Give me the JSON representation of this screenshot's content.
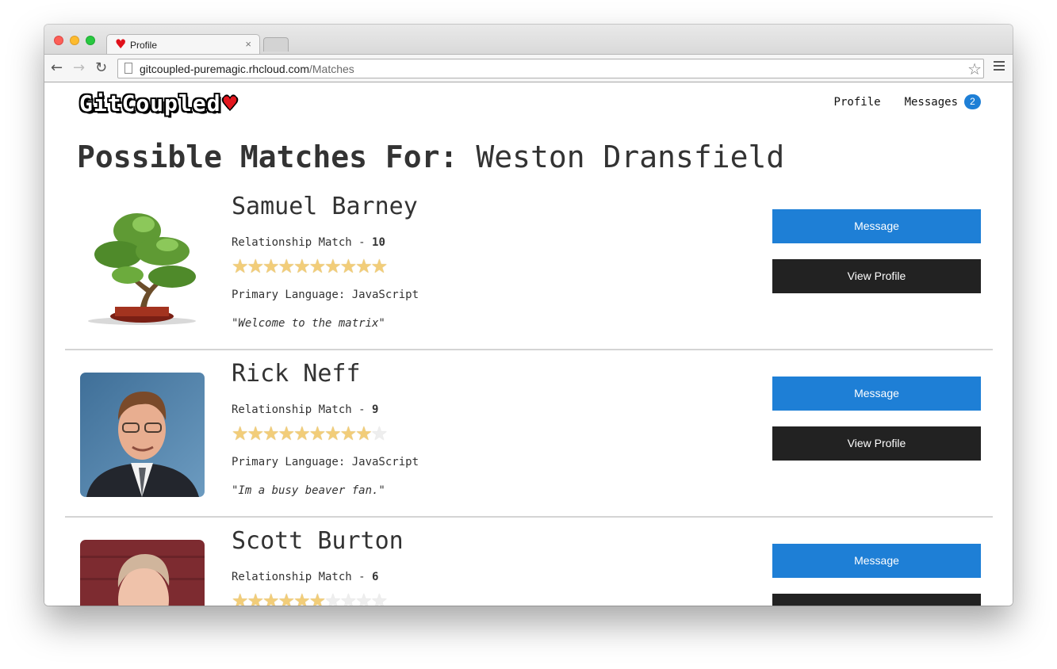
{
  "browser": {
    "tab_title": "Profile",
    "tab_favicon": "heart-icon",
    "tab_close": "×",
    "url_host": "gitcoupled-puremagic.rhcloud.com",
    "url_path": "/Matches"
  },
  "site": {
    "logo_text": "GitCoupled",
    "logo_heart": "♥",
    "nav": {
      "profile": "Profile",
      "messages": "Messages",
      "messages_count": "2"
    }
  },
  "heading": {
    "prefix": "Possible Matches For:",
    "name": "Weston Dransfield"
  },
  "labels": {
    "relationship": "Relationship Match - ",
    "primary_language": "Primary Language: ",
    "message_button": "Message",
    "view_profile_button": "View Profile"
  },
  "matches": [
    {
      "name": "Samuel Barney",
      "score": "10",
      "stars": 10,
      "max_stars": 10,
      "language": "JavaScript",
      "quote": "\"Welcome to the matrix\"",
      "avatar": "bonsai-tree"
    },
    {
      "name": "Rick Neff",
      "score": "9",
      "stars": 9,
      "max_stars": 10,
      "language": "JavaScript",
      "quote": "\"Im a busy beaver fan.\"",
      "avatar": "man-photo"
    },
    {
      "name": "Scott Burton",
      "score": "6",
      "stars": 6,
      "max_stars": 10,
      "language": "",
      "quote": "",
      "avatar": "man-photo"
    }
  ],
  "colors": {
    "accent": "#1e7fd6",
    "dark_button": "#222222",
    "star_on": "#f2cd79"
  }
}
